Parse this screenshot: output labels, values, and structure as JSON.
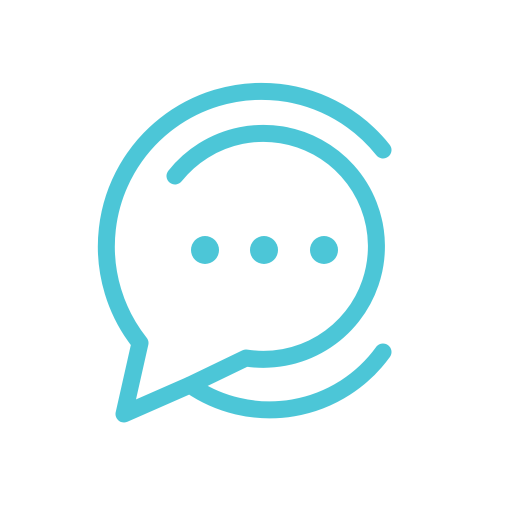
{
  "icon": {
    "name": "chat-bubble-logo-icon",
    "accent_color": "#4CC6D7",
    "background_color": "#FFFFFF",
    "typing_indicator_dot_count": 3
  }
}
